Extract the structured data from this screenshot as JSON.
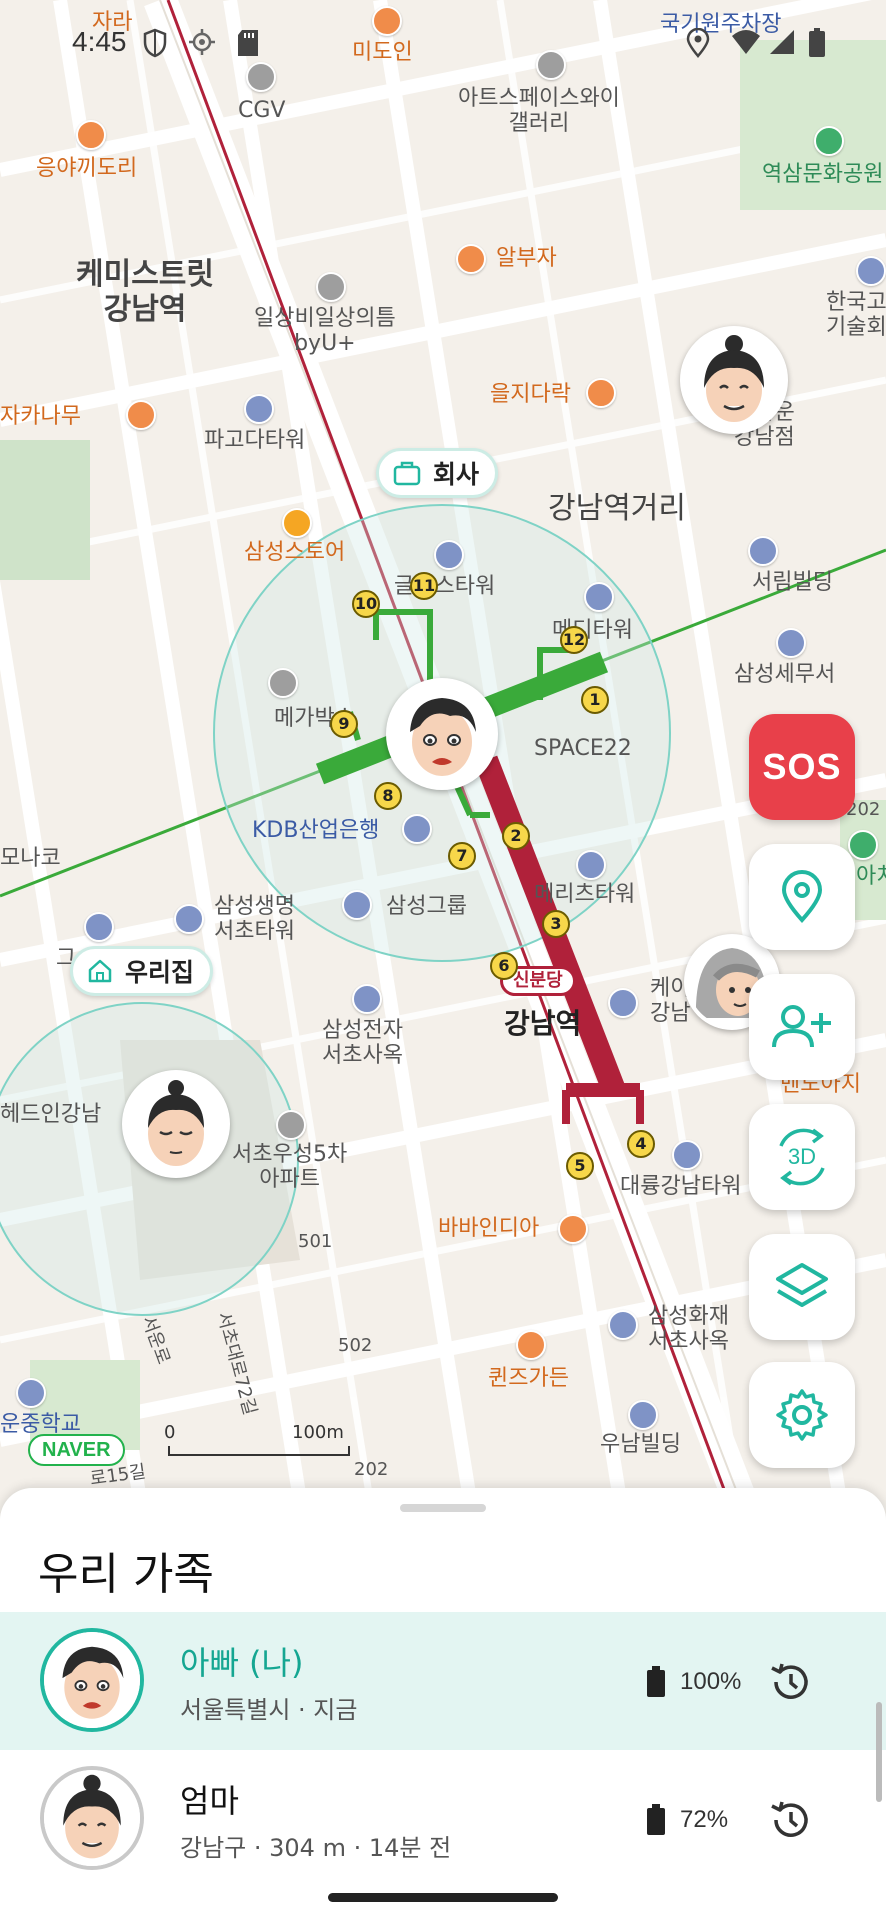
{
  "status_bar": {
    "time": "4:45",
    "icons": [
      "shield-icon",
      "location-target-icon",
      "sd-card-icon",
      "location-pin-icon",
      "wifi-icon",
      "signal-icon",
      "battery-icon"
    ]
  },
  "map": {
    "labels": {
      "jara": "자라",
      "midoin": "미도인",
      "gukgi": "국기원주차장",
      "cgv": "CGV",
      "art_space": "아트스페이스와이\n갤러리",
      "eungya": "응야끼도리",
      "yeoksam_park": "역삼문화공원",
      "chemistreet": "케미스트릿\n강남역",
      "albuja": "알부자",
      "ilsang": "일상비일상의틈\nbyU+",
      "hanguk": "한국고\n기술회",
      "jakanamu": "자카나무",
      "pagoda": "파고다타워",
      "euljidarak": "을지다락",
      "geontaun": "건타운\n강남점",
      "gangnam_street": "강남역거리",
      "samsung_store": "삼성스토어",
      "glass_tower": "글라스타워",
      "seorim": "서림빌딩",
      "media_tower": "메디타워",
      "samsung_semusa": "삼성세무서",
      "megabox": "메가박스",
      "space22": "SPACE22",
      "kdb": "KDB산업은행",
      "monaco": "모나코",
      "num_202a": "202",
      "achi": "아치",
      "samsung_life": "삼성생명\n서초타워",
      "samsung_group": "삼성그룹",
      "merits": "메리츠타워",
      "gu": "그",
      "shinbundang": "신분당",
      "kei": "케이\n강남",
      "samsung_elec": "삼성전자\n서초사옥",
      "gangnam_station": "강남역",
      "bendoaji": "벤도아지",
      "hedin": "헤드인강남",
      "seocho_apt": "서초우성5차\n아파트",
      "daeryung": "대륭강남타워",
      "num_501": "501",
      "bavindia": "바바인디아",
      "seoun_ro": "서운로",
      "seochodae_ro": "서초대로72길",
      "num_502": "502",
      "samsung_fire": "삼성화재\n서초사옥",
      "queens_garden": "퀸즈가든",
      "unjung": "운중학교",
      "woonam": "우남빌딩",
      "num_202b": "202",
      "num_15": "로15길"
    },
    "exits": [
      "1",
      "2",
      "3",
      "4",
      "5",
      "6",
      "7",
      "8",
      "9",
      "10",
      "11",
      "12"
    ],
    "place_tags": {
      "company": "회사",
      "home": "우리집"
    },
    "naver_logo": "NAVER",
    "scale": {
      "start": "0",
      "end": "100m"
    }
  },
  "fab_buttons": {
    "sos": "SOS",
    "three_d": "3D"
  },
  "sheet": {
    "title": "우리 가족",
    "members": [
      {
        "name": "아빠 (나)",
        "subtitle": "서울특별시 · 지금",
        "battery": "100%",
        "battery_level": 1.0,
        "selected": true
      },
      {
        "name": "엄마",
        "subtitle": "강남구 · 304 m · 14분 전",
        "battery": "72%",
        "battery_level": 0.72,
        "selected": false
      }
    ]
  },
  "colors": {
    "accent": "#21b7a0",
    "sos": "#e8404a",
    "line2_green": "#3aaa3a",
    "shinbundang_red": "#b0213a",
    "selected_row": "#e3f5f2"
  }
}
